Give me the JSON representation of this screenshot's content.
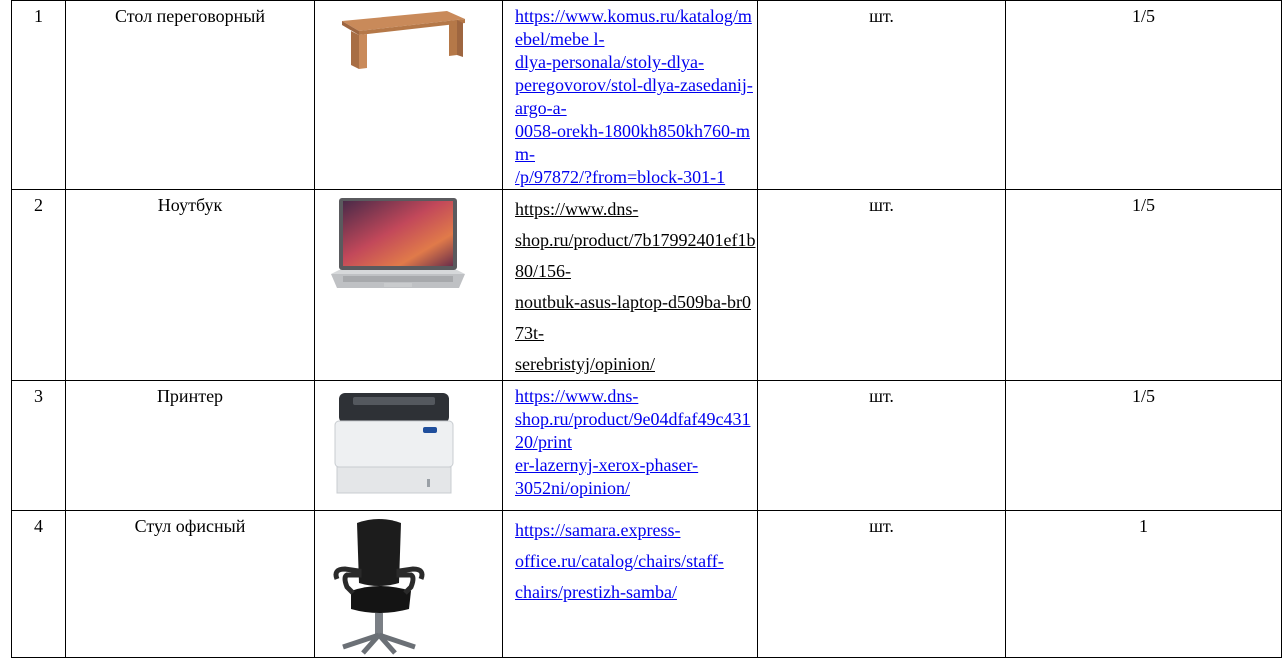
{
  "rows": [
    {
      "num": "1",
      "name": "Стол переговорный",
      "image": "table-image",
      "url_lines": [
        "https://www.komus.ru/katalog/mebel/mebe l-",
        "dlya-personala/stoly-dlya-",
        "peregovorov/stol-dlya-zasedanij-argo-a-",
        "0058-orekh-1800kh850kh760-mm-",
        "/p/97872/?from=block-301-1"
      ],
      "unit": "шт.",
      "qty": "1/5"
    },
    {
      "num": "2",
      "name": "Ноутбук",
      "image": "laptop-image",
      "url_lines": [
        "https://www.dns-",
        "shop.ru/product/7b17992401ef1b80/156-",
        "noutbuk-asus-laptop-d509ba-br073t-",
        "serebristyj/opinion/"
      ],
      "unit": "шт.",
      "qty": "1/5"
    },
    {
      "num": "3",
      "name": "Принтер",
      "image": "printer-image",
      "url_lines": [
        "https://www.dns-",
        "shop.ru/product/9e04dfaf49c43120/print",
        "er-lazernyj-xerox-phaser-",
        "3052ni/opinion/"
      ],
      "unit": "шт.",
      "qty": "1/5"
    },
    {
      "num": "4",
      "name": "Стул офисный",
      "image": "office-chair-image",
      "url_lines": [
        "https://samara.express-",
        "office.ru/catalog/chairs/staff-",
        "chairs/prestizh-samba/"
      ],
      "unit": "шт.",
      "qty": "1"
    }
  ]
}
